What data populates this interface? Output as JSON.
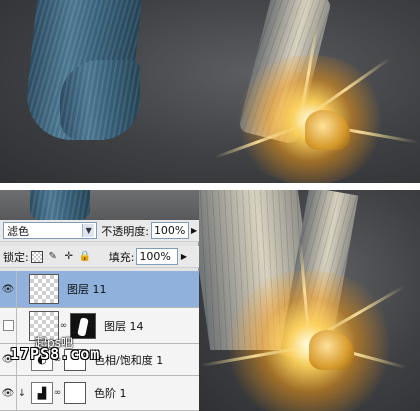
{
  "layers_panel": {
    "blend_mode": "滤色",
    "opacity_label": "不透明度:",
    "opacity_value": "100%",
    "lock_label": "锁定:",
    "fill_label": "填充:",
    "fill_value": "100%",
    "layers": [
      {
        "name": "图层 11",
        "visible": true,
        "selected": true
      },
      {
        "name": "图层 14",
        "visible": false,
        "selected": false
      },
      {
        "name": "色相/饱和度 1",
        "visible": true,
        "selected": false
      },
      {
        "name": "色阶 1",
        "visible": true,
        "selected": false
      }
    ]
  },
  "watermark": {
    "top": "起ps吧",
    "main": "17PS8.com"
  },
  "colors": {
    "selected_row": "#8fb1dc",
    "panel_bg": "#e4e4e4",
    "glow": "#ffcc55",
    "denim": "#3b6580"
  }
}
